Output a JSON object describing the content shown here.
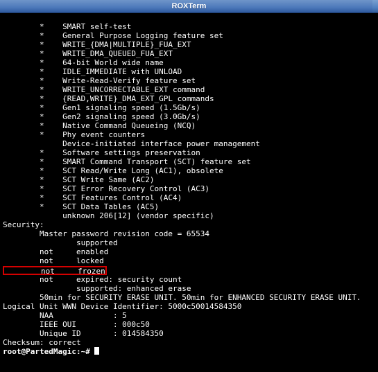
{
  "title": "ROXTerm",
  "lines": [
    "        *    SMART self-test",
    "        *    General Purpose Logging feature set",
    "        *    WRITE_{DMA|MULTIPLE}_FUA_EXT",
    "        *    WRITE_DMA_QUEUED_FUA_EXT",
    "        *    64-bit World wide name",
    "        *    IDLE_IMMEDIATE with UNLOAD",
    "        *    Write-Read-Verify feature set",
    "        *    WRITE_UNCORRECTABLE_EXT command",
    "        *    {READ,WRITE}_DMA_EXT_GPL commands",
    "        *    Gen1 signaling speed (1.5Gb/s)",
    "        *    Gen2 signaling speed (3.0Gb/s)",
    "        *    Native Command Queueing (NCQ)",
    "        *    Phy event counters",
    "             Device-initiated interface power management",
    "        *    Software settings preservation",
    "        *    SMART Command Transport (SCT) feature set",
    "        *    SCT Read/Write Long (AC1), obsolete",
    "        *    SCT Write Same (AC2)",
    "        *    SCT Error Recovery Control (AC3)",
    "        *    SCT Features Control (AC4)",
    "        *    SCT Data Tables (AC5)",
    "             unknown 206[12] (vendor specific)",
    "Security:",
    "        Master password revision code = 65534",
    "                supported",
    "        not     enabled",
    "        not     locked"
  ],
  "highlight_line": "        not     frozen",
  "lines_after": [
    "        not     expired: security count",
    "                supported: enhanced erase",
    "        50min for SECURITY ERASE UNIT. 50min for ENHANCED SECURITY ERASE UNIT.",
    "Logical Unit WWN Device Identifier: 5000c50014584350",
    "        NAA             : 5",
    "        IEEE OUI        : 000c50",
    "        Unique ID       : 014584350",
    "Checksum: correct"
  ],
  "prompt": "root@PartedMagic:~# "
}
